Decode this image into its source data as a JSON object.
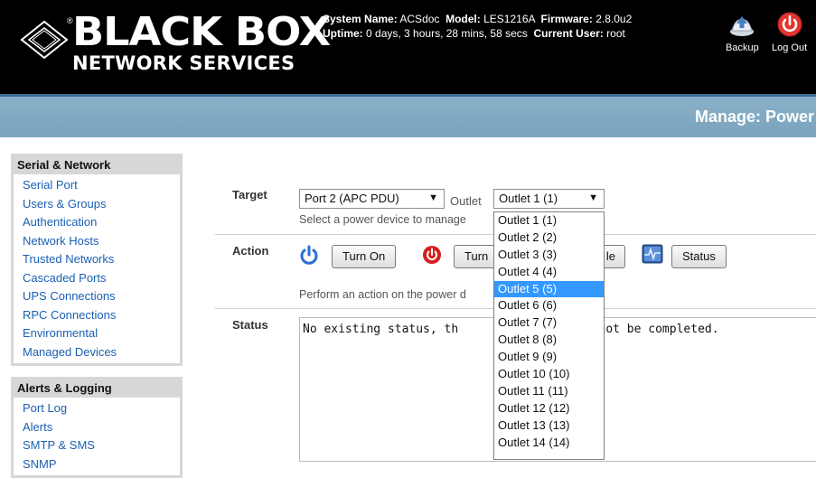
{
  "header": {
    "logo_title": "BLACK BOX",
    "logo_sub": "NETWORK SERVICES",
    "logo_reg": "®",
    "system_name_label": "System Name:",
    "system_name": "ACSdoc",
    "model_label": "Model:",
    "model": "LES1216A",
    "firmware_label": "Firmware:",
    "firmware": "2.8.0u2",
    "uptime_label": "Uptime:",
    "uptime": "0 days, 3 hours, 28 mins, 58 secs",
    "current_user_label": "Current User:",
    "current_user": "root",
    "backup_label": "Backup",
    "logout_label": "Log Out"
  },
  "page_title": "Manage: Power",
  "sidebar": {
    "sections": [
      {
        "title": "Serial & Network",
        "items": [
          "Serial Port",
          "Users & Groups",
          "Authentication",
          "Network Hosts",
          "Trusted Networks",
          "Cascaded Ports",
          "UPS Connections",
          "RPC Connections",
          "Environmental",
          "Managed Devices"
        ]
      },
      {
        "title": "Alerts & Logging",
        "items": [
          "Port Log",
          "Alerts",
          "SMTP & SMS",
          "SNMP"
        ]
      }
    ]
  },
  "main": {
    "target_label": "Target",
    "target_value": "Port 2 (APC PDU)",
    "outlet_label": "Outlet",
    "outlet_value": "Outlet 1 (1)",
    "target_help": "Select a power device to manage",
    "action_label": "Action",
    "turn_on": "Turn On",
    "turn_off_partial": "Turn",
    "cycle_partial": "le",
    "status_button": "Status",
    "action_help": "Perform an action on the power d",
    "status_label": "Status",
    "status_text": "No existing status, th",
    "status_text_tail": "may not be completed."
  },
  "dropdown": {
    "options": [
      "Outlet 1 (1)",
      "Outlet 2 (2)",
      "Outlet 3 (3)",
      "Outlet 4 (4)",
      "Outlet 5 (5)",
      "Outlet 6 (6)",
      "Outlet 7 (7)",
      "Outlet 8 (8)",
      "Outlet 9 (9)",
      "Outlet 10 (10)",
      "Outlet 11 (11)",
      "Outlet 12 (12)",
      "Outlet 13 (13)",
      "Outlet 14 (14)"
    ],
    "highlighted": "Outlet 5 (5)"
  },
  "colors": {
    "header_bg": "#000000",
    "titlebar_bg": "#7fa8c2",
    "link": "#1a5fb4",
    "highlight": "#3399ff",
    "power_on_blue": "#2a6fd6",
    "power_off_red": "#d61f1f"
  },
  "icons": [
    "brand-diamond-icon",
    "backup-icon",
    "logout-power-icon",
    "power-on-icon",
    "power-off-icon",
    "status-monitor-icon",
    "chevron-down-icon"
  ]
}
